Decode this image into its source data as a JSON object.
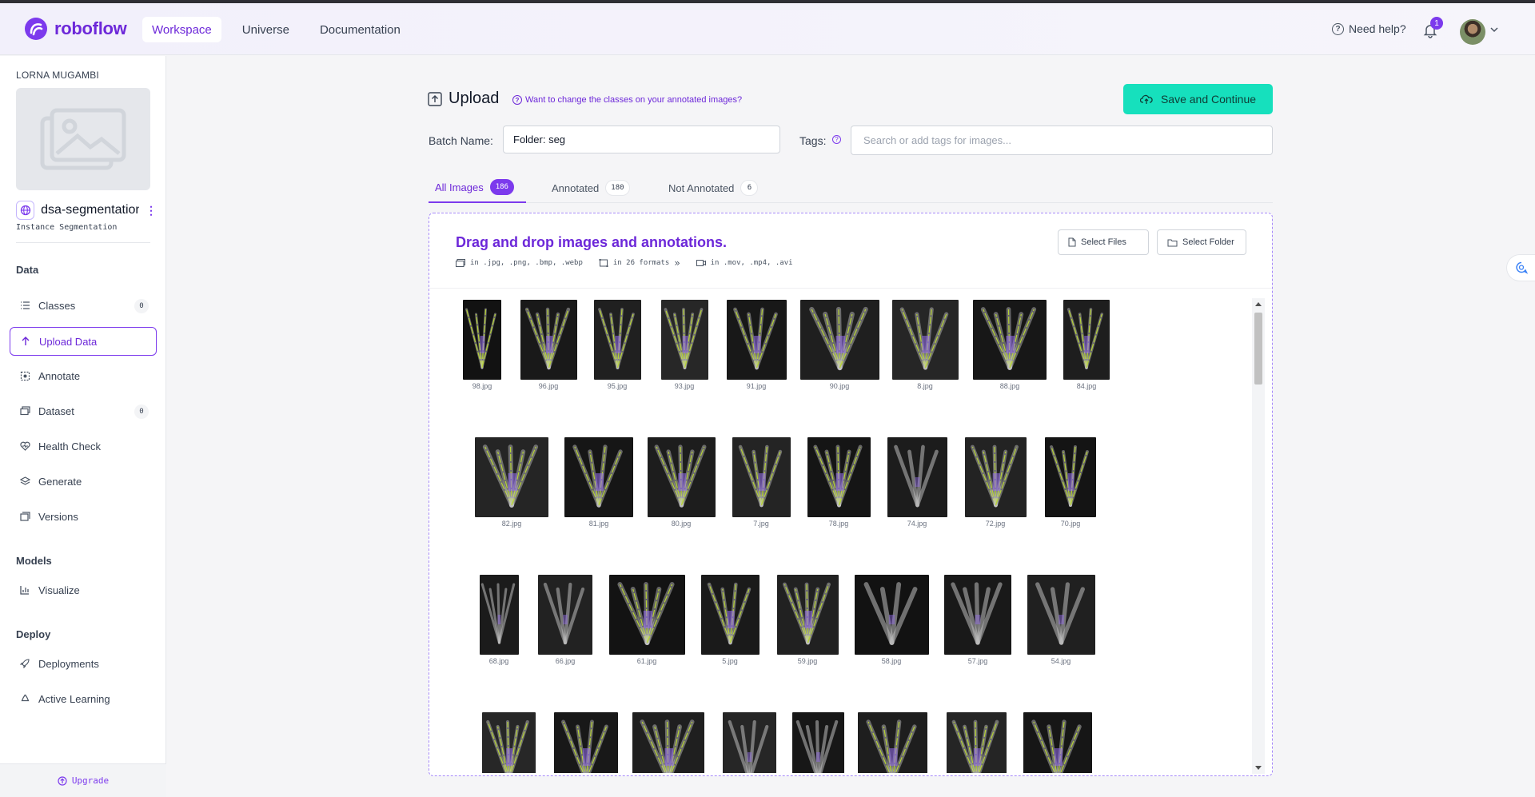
{
  "brand": {
    "name": "roboflow",
    "accent": "#7c3aed"
  },
  "nav": {
    "items": [
      {
        "label": "Workspace",
        "active": true
      },
      {
        "label": "Universe"
      },
      {
        "label": "Documentation"
      }
    ]
  },
  "header": {
    "help_label": "Need help?",
    "notification_count": "1"
  },
  "sidebar": {
    "workspace_name": "LORNA MUGAMBI",
    "project_name": "dsa-segmentation",
    "project_type": "Instance Segmentation",
    "sections": {
      "data": "Data",
      "models": "Models",
      "deploy": "Deploy"
    },
    "items": {
      "classes": {
        "label": "Classes",
        "count": "0"
      },
      "upload": {
        "label": "Upload Data"
      },
      "annotate": {
        "label": "Annotate"
      },
      "dataset": {
        "label": "Dataset",
        "count": "0"
      },
      "health": {
        "label": "Health Check"
      },
      "generate": {
        "label": "Generate"
      },
      "versions": {
        "label": "Versions"
      },
      "visualize": {
        "label": "Visualize"
      },
      "deployments": {
        "label": "Deployments"
      },
      "active_learning": {
        "label": "Active Learning"
      }
    },
    "upgrade_label": "Upgrade"
  },
  "upload": {
    "title": "Upload",
    "classes_link": "Want to change the classes on your annotated images?",
    "save_label": "Save and Continue",
    "batch_label": "Batch Name:",
    "batch_value": "Folder: seg",
    "tags_label": "Tags:",
    "tags_placeholder": "Search or add tags for images..."
  },
  "tabs": [
    {
      "label": "All Images",
      "count": "186",
      "active": true
    },
    {
      "label": "Annotated",
      "count": "180"
    },
    {
      "label": "Not Annotated",
      "count": "6"
    }
  ],
  "dropzone": {
    "title": "Drag and drop images and annotations.",
    "image_formats": "in .jpg, .png, .bmp, .webp",
    "annotation_formats": "in 26 formats",
    "video_formats": "in .mov, .mp4, .avi",
    "select_files": "Select Files",
    "select_folder": "Select Folder"
  },
  "images": [
    {
      "name": "98.jpg",
      "annotated": true
    },
    {
      "name": "96.jpg",
      "annotated": true
    },
    {
      "name": "95.jpg",
      "annotated": true
    },
    {
      "name": "93.jpg",
      "annotated": true
    },
    {
      "name": "91.jpg",
      "annotated": true
    },
    {
      "name": "90.jpg",
      "annotated": true
    },
    {
      "name": "8.jpg",
      "annotated": true
    },
    {
      "name": "88.jpg",
      "annotated": true
    },
    {
      "name": "84.jpg",
      "annotated": true
    },
    {
      "name": "82.jpg",
      "annotated": true
    },
    {
      "name": "81.jpg",
      "annotated": true
    },
    {
      "name": "80.jpg",
      "annotated": true
    },
    {
      "name": "7.jpg",
      "annotated": true
    },
    {
      "name": "78.jpg",
      "annotated": true
    },
    {
      "name": "74.jpg",
      "annotated": false
    },
    {
      "name": "72.jpg",
      "annotated": true
    },
    {
      "name": "70.jpg",
      "annotated": true
    },
    {
      "name": "68.jpg",
      "annotated": false
    },
    {
      "name": "66.jpg",
      "annotated": false
    },
    {
      "name": "61.jpg",
      "annotated": true
    },
    {
      "name": "5.jpg",
      "annotated": true
    },
    {
      "name": "59.jpg",
      "annotated": true
    },
    {
      "name": "58.jpg",
      "annotated": false
    },
    {
      "name": "57.jpg",
      "annotated": false
    },
    {
      "name": "54.jpg",
      "annotated": false
    },
    {
      "name": "",
      "annotated": true
    },
    {
      "name": "",
      "annotated": true
    },
    {
      "name": "",
      "annotated": true
    },
    {
      "name": "",
      "annotated": false
    },
    {
      "name": "",
      "annotated": false
    },
    {
      "name": "",
      "annotated": true
    },
    {
      "name": "",
      "annotated": true
    },
    {
      "name": "",
      "annotated": true
    }
  ]
}
